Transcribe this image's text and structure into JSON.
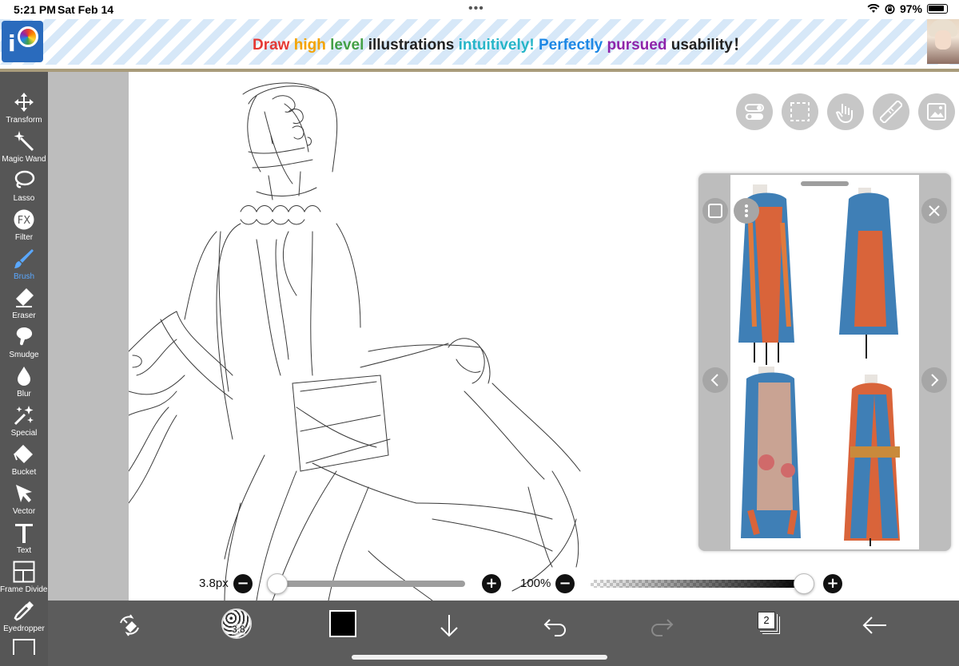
{
  "status_bar": {
    "time": "5:21 PM",
    "date": "Sat Feb 14",
    "battery": "97%"
  },
  "banner": {
    "segments": [
      {
        "text": "Draw ",
        "color": "#e53935"
      },
      {
        "text": "high ",
        "color": "#f4a300"
      },
      {
        "text": "level ",
        "color": "#43a047"
      },
      {
        "text": "illustrations ",
        "color": "#222222"
      },
      {
        "text": "intuitively! ",
        "color": "#26b5c8"
      },
      {
        "text": "Perfectly ",
        "color": "#1e88e5"
      },
      {
        "text": "pursued ",
        "color": "#8e24aa"
      },
      {
        "text": "usability",
        "color": "#222222"
      },
      {
        "text": "！",
        "color": "#222222"
      }
    ]
  },
  "toolbar": {
    "items": [
      {
        "label": "Transform",
        "icon": "move-arrows-icon"
      },
      {
        "label": "Magic Wand",
        "icon": "magic-wand-icon"
      },
      {
        "label": "Lasso",
        "icon": "lasso-icon"
      },
      {
        "label": "Filter",
        "icon": "fx-icon"
      },
      {
        "label": "Brush",
        "icon": "brush-icon",
        "active": true
      },
      {
        "label": "Eraser",
        "icon": "eraser-icon"
      },
      {
        "label": "Smudge",
        "icon": "smudge-icon"
      },
      {
        "label": "Blur",
        "icon": "droplet-icon"
      },
      {
        "label": "Special",
        "icon": "sparkle-icon"
      },
      {
        "label": "Bucket",
        "icon": "bucket-icon"
      },
      {
        "label": "Vector",
        "icon": "cursor-arrow-icon"
      },
      {
        "label": "Text",
        "icon": "text-icon"
      },
      {
        "label": "Frame Divider",
        "icon": "frame-divider-icon"
      },
      {
        "label": "Eyedropper",
        "icon": "eyedropper-icon"
      }
    ],
    "active_color": "#5aa8ff"
  },
  "canvas_buttons": [
    "toggle-icon",
    "selection-icon",
    "hand-gesture-icon",
    "ruler-icon",
    "image-icon"
  ],
  "reference_panel": {
    "image_description_icon": "reference-photo",
    "buttons": [
      "square-icon",
      "more-vertical-icon",
      "close-icon",
      "chevron-left-icon",
      "chevron-right-icon"
    ]
  },
  "brush": {
    "size": "3.8px",
    "size_preview": "3.8",
    "size_fraction": 0.02
  },
  "opacity": {
    "value": "100%",
    "fraction": 1.0
  },
  "bottom_bar": {
    "color": "#000000",
    "layer_count": "2"
  }
}
